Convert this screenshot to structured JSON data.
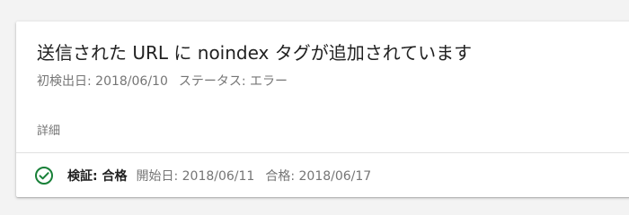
{
  "issue": {
    "title_prefix": "送信された",
    "title_url": "URL",
    "title_mid": "に",
    "title_noindex": "noindex",
    "title_suffix": "タグが追加されています",
    "first_detected": "初検出日: 2018/06/10",
    "status": "ステータス: エラー",
    "details_link": "詳細"
  },
  "validation": {
    "label": "検証: 合格",
    "started": "開始日: 2018/06/11",
    "passed": "合格: 2018/06/17",
    "icon": "check-circle-icon",
    "icon_color": "#188038"
  }
}
